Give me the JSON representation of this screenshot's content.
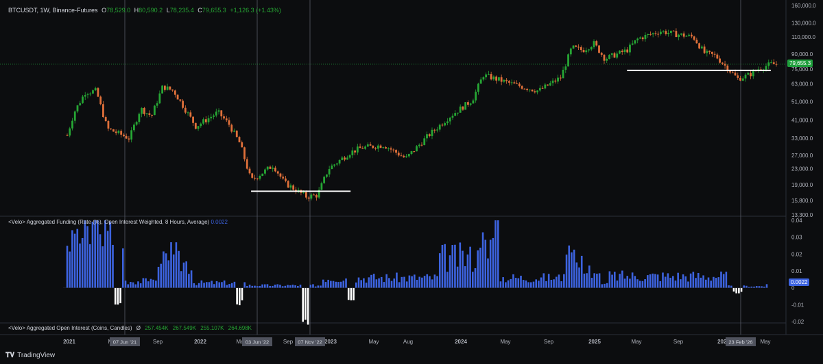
{
  "header": {
    "symbol": "BTCUSDT, 1W, Binance-Futures",
    "open_label": "O",
    "open": "78,529.0",
    "high_label": "H",
    "high": "80,590.2",
    "low_label": "L",
    "low": "78,235.4",
    "close_label": "C",
    "close": "79,655.3",
    "change": "+1,126.3 (+1.43%)"
  },
  "funding": {
    "title": "<Velo> Aggregated Funding (Rate (%), Open Interest Weighted, 8 Hours, Average)",
    "value": "0.0022"
  },
  "open_interest": {
    "title": "<Velo> Aggregated Open Interest (Coins, Candles)",
    "symbol": "Ø",
    "o": "257.454K",
    "h": "267.549K",
    "l": "255.107K",
    "c": "264.698K"
  },
  "price_tag": "79,655.3",
  "funding_tag": "0.0022",
  "price_axis": [
    "160,000.0",
    "130,000.0",
    "110,000.0",
    "90,000.0",
    "75,000.0",
    "63,000.0",
    "51,000.0",
    "41,000.0",
    "33,000.0",
    "27,000.0",
    "23,000.0",
    "19,000.0",
    "15,800.0",
    "13,300.0"
  ],
  "funding_axis": [
    "0.04",
    "0.03",
    "0.02",
    "0.01",
    "0",
    "-0.01",
    "-0.02"
  ],
  "time_axis": [
    "2021",
    "May",
    "Sep",
    "2022",
    "May",
    "Sep",
    "2023",
    "May",
    "Aug",
    "2024",
    "May",
    "Sep",
    "2025",
    "May",
    "Sep",
    "2026",
    "May"
  ],
  "date_tags": [
    "07 Jun '21",
    "03 Jun '22",
    "07 Nov '22",
    "23 Feb '26"
  ],
  "branding": "TradingView",
  "colors": {
    "up": "#26a634",
    "down": "#e0703a",
    "funding": "#3d63e0",
    "negative": "#ffffff",
    "price_line": "#1f9e3c"
  },
  "chart_data": {
    "type": "candlestick",
    "title": "BTCUSDT, 1W, Binance-Futures",
    "y_scale": "log",
    "ylim": [
      13300,
      160000
    ],
    "price_path_usd": [
      [
        "2021-01",
        29000
      ],
      [
        "2021-02",
        45000
      ],
      [
        "2021-03",
        57000
      ],
      [
        "2021-04",
        58000
      ],
      [
        "2021-05",
        37000
      ],
      [
        "2021-06",
        35000
      ],
      [
        "2021-07",
        33000
      ],
      [
        "2021-08",
        47000
      ],
      [
        "2021-09",
        43000
      ],
      [
        "2021-10",
        61000
      ],
      [
        "2021-11",
        58000
      ],
      [
        "2021-12",
        47000
      ],
      [
        "2022-01",
        38000
      ],
      [
        "2022-03",
        45000
      ],
      [
        "2022-04",
        39000
      ],
      [
        "2022-05",
        31000
      ],
      [
        "2022-06",
        20000
      ],
      [
        "2022-08",
        24000
      ],
      [
        "2022-09",
        19500
      ],
      [
        "2022-11",
        16500
      ],
      [
        "2022-12",
        16800
      ],
      [
        "2023-01",
        23000
      ],
      [
        "2023-03",
        28000
      ],
      [
        "2023-04",
        29500
      ],
      [
        "2023-06",
        30500
      ],
      [
        "2023-08",
        26000
      ],
      [
        "2023-10",
        34000
      ],
      [
        "2023-12",
        43000
      ],
      [
        "2024-02",
        52000
      ],
      [
        "2024-03",
        70000
      ],
      [
        "2024-06",
        62000
      ],
      [
        "2024-08",
        58000
      ],
      [
        "2024-10",
        68000
      ],
      [
        "2024-11",
        97000
      ],
      [
        "2024-12",
        94000
      ],
      [
        "2025-01",
        102000
      ],
      [
        "2025-02",
        85000
      ],
      [
        "2025-04",
        94000
      ],
      [
        "2025-05",
        108000
      ],
      [
        "2025-07",
        118000
      ],
      [
        "2025-08",
        115000
      ],
      [
        "2025-10",
        110000
      ],
      [
        "2025-11",
        91000
      ],
      [
        "2025-12",
        88000
      ],
      [
        "2026-02",
        67000
      ],
      [
        "2026-03",
        70000
      ],
      [
        "2026-04",
        76000
      ],
      [
        "2026-05",
        79655
      ]
    ],
    "support_lines_usd": [
      {
        "from": "2022-06",
        "to": "2023-03",
        "value": 17600
      },
      {
        "from": "2025-04",
        "to": "2026-05",
        "value": 74000
      }
    ],
    "funding_rate_percent": {
      "ylim": [
        -0.02,
        0.04
      ],
      "peaks": [
        [
          "2021-02",
          0.04
        ],
        [
          "2021-04",
          0.04
        ],
        [
          "2021-06",
          -0.01
        ],
        [
          "2021-09",
          0.005
        ],
        [
          "2021-10",
          0.02
        ],
        [
          "2021-11",
          0.025
        ],
        [
          "2022-05",
          -0.01
        ],
        [
          "2022-11",
          -0.02
        ],
        [
          "2023-03",
          -0.01
        ],
        [
          "2024-03",
          0.033
        ],
        [
          "2024-04",
          0.04
        ],
        [
          "2024-11",
          0.025
        ],
        [
          "2025-02",
          0.003
        ],
        [
          "2026-02",
          -0.003
        ],
        [
          "2026-05",
          0.0022
        ]
      ]
    }
  }
}
